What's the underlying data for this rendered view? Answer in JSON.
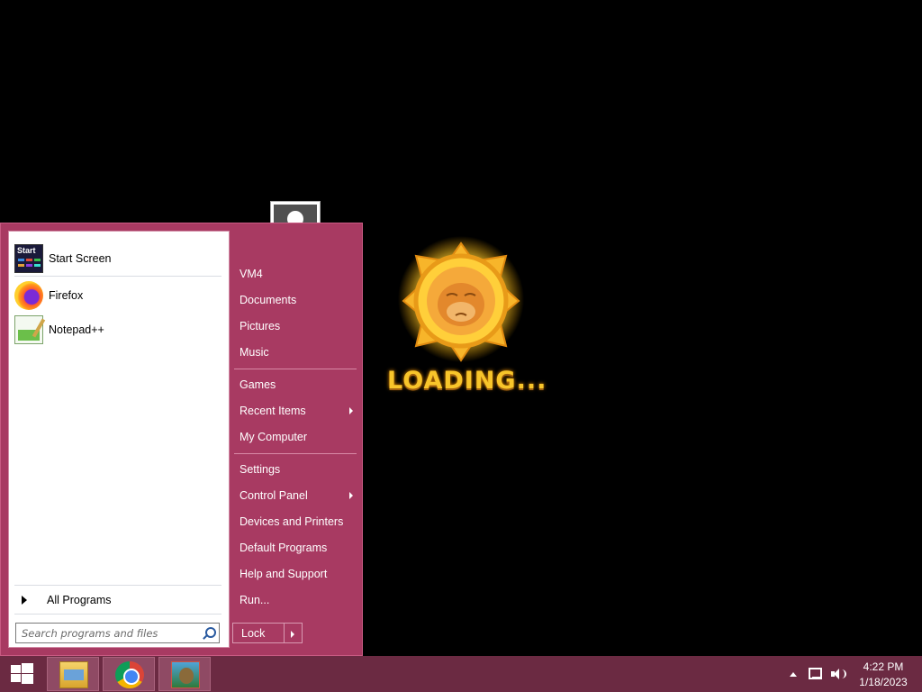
{
  "start_menu": {
    "pinned": [
      {
        "label": "Start Screen",
        "icon": "start-screen-icon"
      },
      {
        "label": "Firefox",
        "icon": "firefox-icon"
      },
      {
        "label": "Notepad++",
        "icon": "notepad-plus-plus-icon"
      }
    ],
    "start_screen_icon_text": "Start",
    "all_programs": "All Programs",
    "search_placeholder": "Search programs and files",
    "right_items": [
      {
        "label": "VM4"
      },
      {
        "label": "Documents"
      },
      {
        "label": "Pictures"
      },
      {
        "label": "Music"
      },
      {
        "label": "Games"
      },
      {
        "label": "Recent Items",
        "submenu": true
      },
      {
        "label": "My Computer"
      },
      {
        "label": "Settings"
      },
      {
        "label": "Control Panel",
        "submenu": true
      },
      {
        "label": "Devices and Printers"
      },
      {
        "label": "Default Programs"
      },
      {
        "label": "Help and Support"
      },
      {
        "label": "Run..."
      }
    ],
    "lock_label": "Lock"
  },
  "loading": {
    "text": "LOADING..."
  },
  "taskbar": {
    "apps": [
      "file-explorer-icon",
      "chrome-icon",
      "bloons-td-icon"
    ],
    "clock_time": "4:22 PM",
    "clock_date": "1/18/2023"
  },
  "colors": {
    "menu_bg": "#a83a62",
    "taskbar_bg": "#6b2a42",
    "loading_gold": "#f8c52a"
  }
}
